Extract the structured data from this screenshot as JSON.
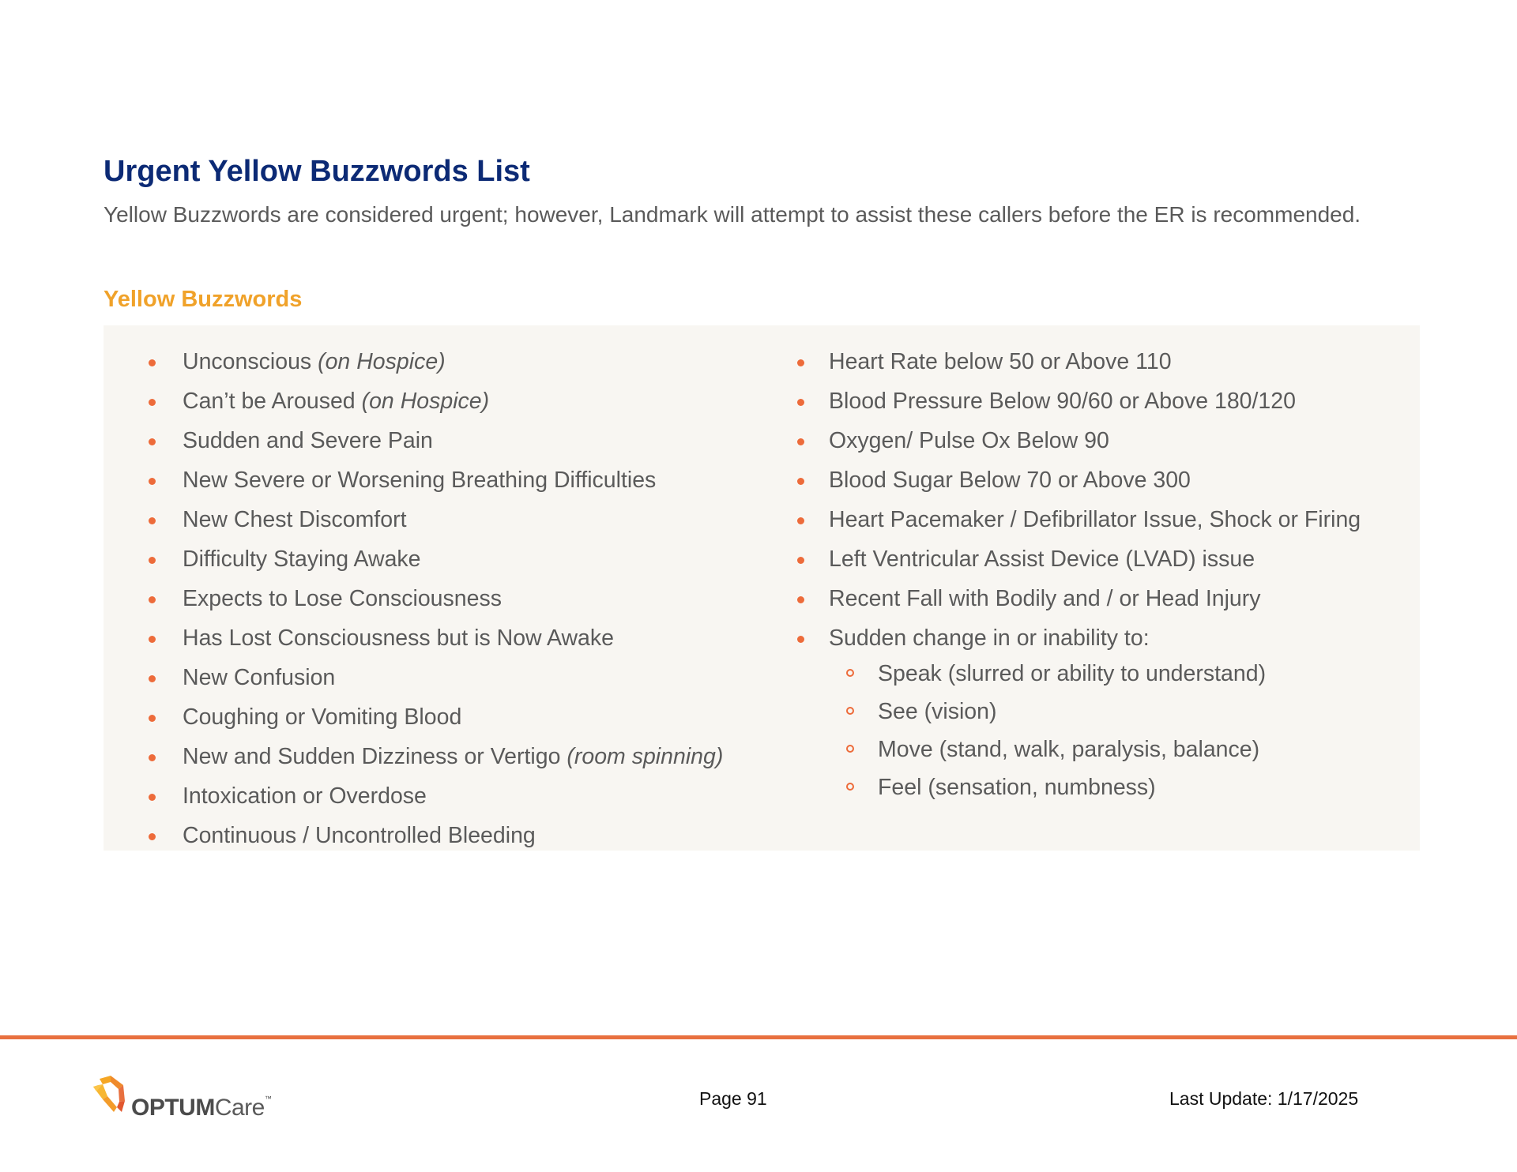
{
  "title": "Urgent Yellow Buzzwords List",
  "intro": "Yellow Buzzwords are considered urgent; however, Landmark will attempt to assist these callers before the ER is recommended.",
  "section_heading": "Yellow Buzzwords",
  "left_column": [
    {
      "text": "Unconscious",
      "italic": "(on Hospice)"
    },
    {
      "text": "Can’t be Aroused",
      "italic": "(on Hospice)"
    },
    {
      "text": "Sudden and Severe Pain",
      "italic": ""
    },
    {
      "text": "New Severe or Worsening Breathing Difficulties",
      "italic": ""
    },
    {
      "text": "New Chest Discomfort",
      "italic": ""
    },
    {
      "text": "Difficulty Staying Awake",
      "italic": ""
    },
    {
      "text": "Expects to Lose Consciousness",
      "italic": ""
    },
    {
      "text": "Has Lost Consciousness but is Now Awake",
      "italic": ""
    },
    {
      "text": "New Confusion",
      "italic": ""
    },
    {
      "text": "Coughing or Vomiting Blood",
      "italic": ""
    },
    {
      "text": "New and Sudden Dizziness or Vertigo",
      "italic": "(room spinning)"
    },
    {
      "text": "Intoxication or Overdose",
      "italic": ""
    },
    {
      "text": "Continuous / Uncontrolled Bleeding",
      "italic": ""
    }
  ],
  "right_column": [
    "Heart Rate below 50 or Above 110",
    "Blood Pressure Below 90/60 or Above 180/120",
    "Oxygen/ Pulse Ox Below 90",
    "Blood Sugar Below 70 or Above 300",
    "Heart Pacemaker / Defibrillator Issue, Shock or Firing",
    "Left Ventricular Assist Device (LVAD) issue",
    "Recent Fall with Bodily and / or Head Injury",
    "Sudden change in or inability to:"
  ],
  "right_sublist": [
    "Speak (slurred or ability to understand)",
    "See (vision)",
    "Move (stand, walk, paralysis, balance)",
    "Feel (sensation, numbness)"
  ],
  "footer": {
    "logo_name": "OPTUM",
    "logo_suffix": "Care",
    "logo_tm": "™",
    "page": "Page 91",
    "last_update": "Last Update: 1/17/2025"
  },
  "colors": {
    "title": "#0c2a75",
    "section_heading": "#f0a22a",
    "bullet": "#ed6b3a",
    "panel": "#f8f6f2",
    "rule": "#e8703f"
  }
}
